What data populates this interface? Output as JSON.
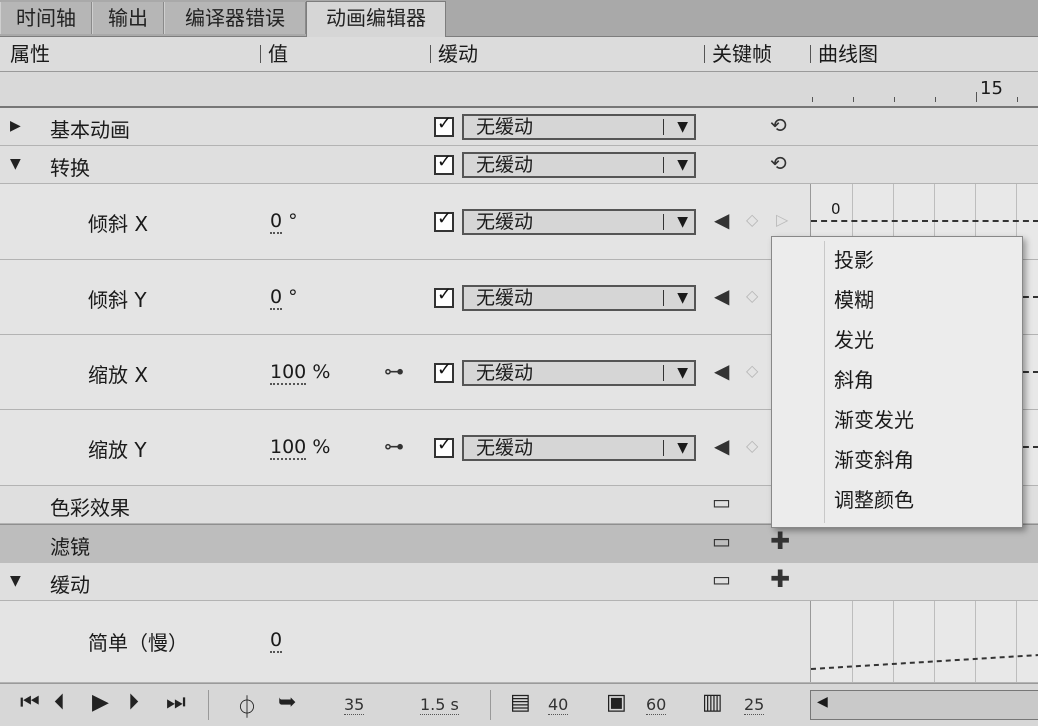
{
  "tabs": [
    "时间轴",
    "输出",
    "编译器错误",
    "动画编辑器"
  ],
  "columns": {
    "property": "属性",
    "value": "值",
    "ease": "缓动",
    "keyframe": "关键帧",
    "graph": "曲线图"
  },
  "ruler": {
    "frame_label": "15"
  },
  "rows": {
    "basic_motion": {
      "label": "基本动画",
      "ease": "无缓动"
    },
    "transform": {
      "label": "转换",
      "ease": "无缓动"
    },
    "skew_x": {
      "label": "倾斜 X",
      "value": "0",
      "unit": "°",
      "ease": "无缓动",
      "graph_value": "0"
    },
    "skew_y": {
      "label": "倾斜 Y",
      "value": "0",
      "unit": "°",
      "ease": "无缓动"
    },
    "scale_x": {
      "label": "缩放 X",
      "value": "100",
      "unit": "%",
      "ease": "无缓动"
    },
    "scale_y": {
      "label": "缩放 Y",
      "value": "100",
      "unit": "%",
      "ease": "无缓动"
    },
    "color_effect": {
      "label": "色彩效果"
    },
    "filters": {
      "label": "滤镜"
    },
    "easing": {
      "label": "缓动"
    },
    "simple_slow": {
      "label": "简单（慢）",
      "value": "0"
    }
  },
  "filter_menu": [
    "投影",
    "模糊",
    "发光",
    "斜角",
    "渐变发光",
    "渐变斜角",
    "调整颜色"
  ],
  "toolbar": {
    "graph_size": "35",
    "duration": "1.5 s",
    "frames_a": "40",
    "frames_b": "60",
    "frames_c": "25"
  }
}
